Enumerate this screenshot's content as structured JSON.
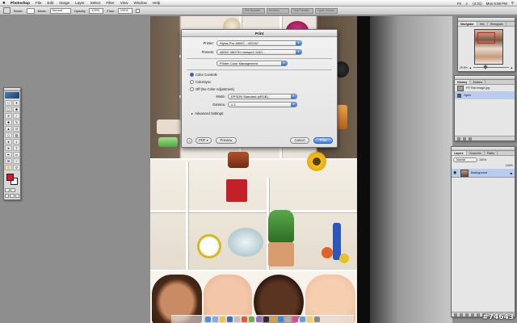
{
  "menubar": {
    "apple": "",
    "items": [
      "Photoshop",
      "File",
      "Edit",
      "Image",
      "Layer",
      "Select",
      "Filter",
      "View",
      "Window",
      "Help"
    ],
    "status": {
      "zoom": "Fit",
      "battery": "(2:31)",
      "clock": "Mon 6:59 PM"
    }
  },
  "options_bar": {
    "brush_label": "Brush:",
    "mode_label": "Mode:",
    "mode_value": "Normal",
    "opacity_label": "Opacity:",
    "opacity_value": "100%",
    "flow_label": "Flow:",
    "flow_value": "100%",
    "wells": [
      "File Browser",
      "Brushes",
      "Tool Presets",
      "Layer Comps"
    ]
  },
  "print_dialog": {
    "title": "Print",
    "printer_label": "Printer:",
    "printer_value": "Stylus Pro 4800C - 432267",
    "presets_label": "Presets:",
    "presets_value": "4800C 080731 noespe2 1440...",
    "panel_value": "Printer Color Management",
    "radio_color_controls": "Color Controls",
    "radio_colorsync": "ColorSync",
    "radio_off": "Off (No Color Adjustment)",
    "selected_radio": "Color Controls",
    "mode_label": "Mode:",
    "mode_value": "EPSON Standard (sRGB)",
    "gamma_label": "Gamma:",
    "gamma_value": "2.2",
    "advanced_label": "Advanced Settings:",
    "help": "?",
    "pdf_button": "PDF ▾",
    "preview_button": "Preview",
    "cancel_button": "Cancel",
    "print_button": "Print"
  },
  "navigator": {
    "tabs": [
      "Navigator",
      "Info",
      "Histogram"
    ],
    "active_tab": "Navigator",
    "zoom": "29.9%"
  },
  "history": {
    "tabs": [
      "History",
      "Actions"
    ],
    "items": [
      {
        "label": "FR Test Image.jpg",
        "selected": false
      },
      {
        "label": "Open",
        "selected": true
      }
    ]
  },
  "layers": {
    "tabs": [
      "Layers",
      "Channels",
      "Paths"
    ],
    "blend_mode": "Normal",
    "opacity": "100%",
    "fill": "100%",
    "layer_name": "Background"
  },
  "watermark": "#74643",
  "colors": {
    "foreground": "#e8102a",
    "background": "#ffffff",
    "accent": "#3a7ee0"
  }
}
